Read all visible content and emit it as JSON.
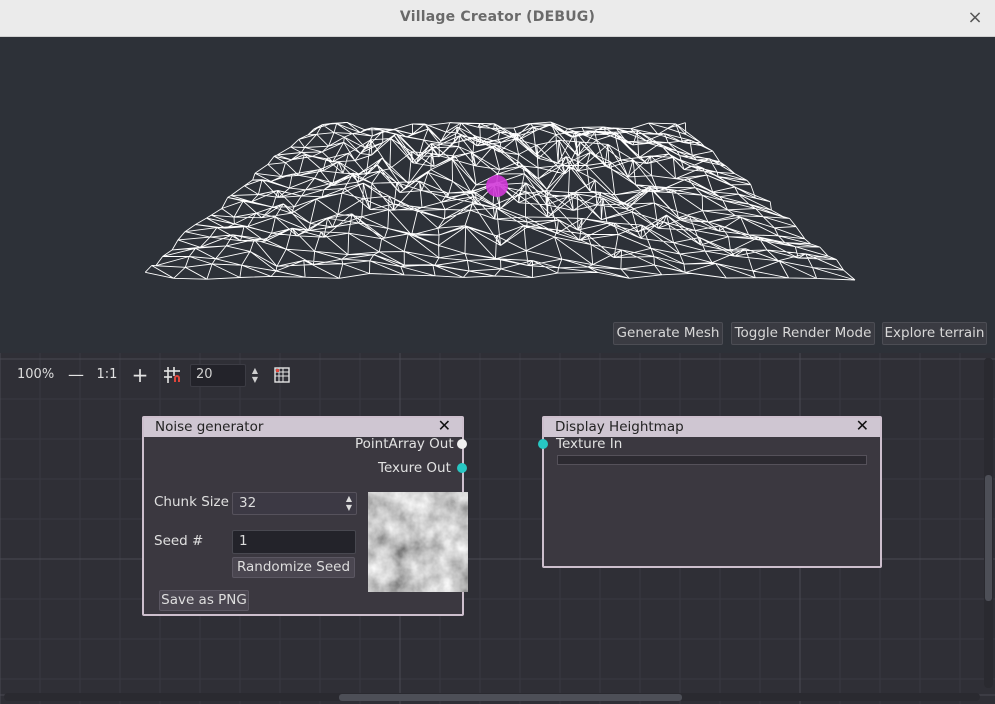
{
  "window": {
    "title": "Village Creator (DEBUG)",
    "close_glyph": "×",
    "close_icon": "close-icon"
  },
  "viewport": {
    "buttons": {
      "generate_mesh": "Generate Mesh",
      "toggle_render_mode": "Toggle Render Mode",
      "explore_terrain": "Explore terrain"
    },
    "marker_color": "#d23ad8",
    "wire_color": "#ffffff"
  },
  "graph_toolbar": {
    "zoom": "100%",
    "zoom_out_glyph": "—",
    "zoom_reset": "1:1",
    "zoom_in_glyph": "+",
    "snap_icon": "grid-snap-icon",
    "snap_value": "20",
    "minimap_icon": "minimap-icon"
  },
  "nodes": {
    "noise_generator": {
      "title": "Noise generator",
      "close_glyph": "✕",
      "outputs": [
        "PointArray Out",
        "Texure Out"
      ],
      "chunk_size_label": "Chunk Size",
      "chunk_size_value": "32",
      "seed_label": "Seed #",
      "seed_value": "1",
      "randomize_button": "Randomize Seed",
      "save_button": "Save as PNG"
    },
    "display_heightmap": {
      "title": "Display Heightmap",
      "close_glyph": "✕",
      "inputs": [
        "Texture In"
      ]
    }
  },
  "colors": {
    "port_white": "#f0f0f0",
    "port_cyan": "#27c7c3",
    "node_header": "#cfc6d2"
  }
}
